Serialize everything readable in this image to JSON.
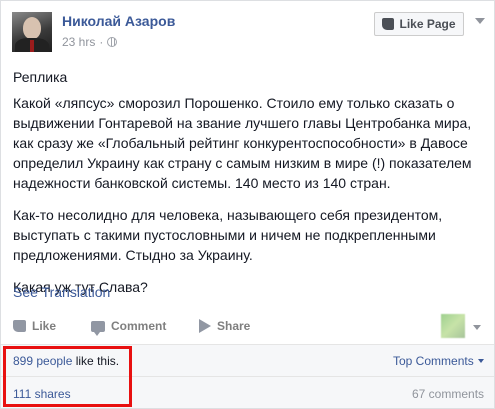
{
  "post": {
    "author": "Николай Азаров",
    "time": "23 hrs",
    "time_separator": "·",
    "like_page_label": "Like Page",
    "paragraphs": [
      "Реплика",
      "Какой «ляпсус» сморозил Порошенко. Стоило ему только сказать о выдвижении Гонтаревой на звание лучшего главы Центробанка мира, как сразу же «Глобальный рейтинг конкурентоспособности» в Давосе определил Украину как страну с самым низким в мире (!) показателем надежности банковской системы. 140 место из 140 стран.",
      "Как-то несолидно для человека, называющего себя президентом, выступать с такими пустословными и ничем не подкрепленными предложениями. Стыдно за Украину.",
      "Какая уж тут Слава?"
    ],
    "see_translation": "See Translation"
  },
  "actions": {
    "like": "Like",
    "comment": "Comment",
    "share": "Share"
  },
  "stats": {
    "people_link": "899 people",
    "likes_suffix": " like this.",
    "top_comments": "Top Comments",
    "shares": "111 shares",
    "comments": "67 comments"
  },
  "colors": {
    "link": "#3b5998",
    "highlight": "#e81010"
  }
}
